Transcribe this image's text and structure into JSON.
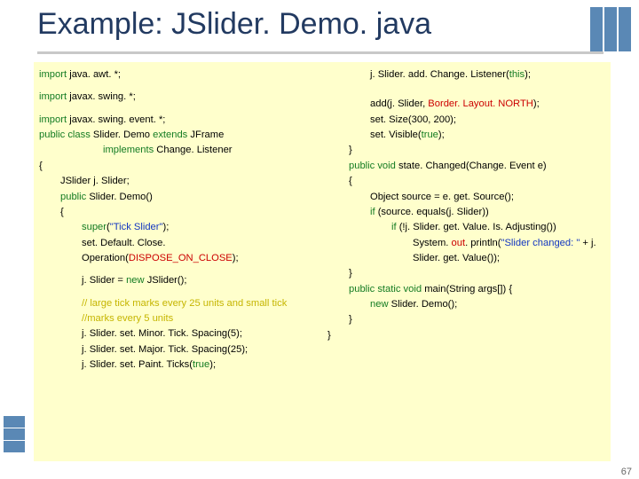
{
  "title": "Example: JSlider. Demo. java",
  "page_number": "67",
  "code": {
    "left": [
      {
        "cls": "",
        "parts": [
          {
            "c": "green",
            "t": "import"
          },
          {
            "t": " java. awt. *;"
          }
        ]
      },
      {
        "cls": "blank"
      },
      {
        "cls": "",
        "parts": [
          {
            "c": "green",
            "t": "import"
          },
          {
            "t": " javax. swing. *;"
          }
        ]
      },
      {
        "cls": "blank"
      },
      {
        "cls": "",
        "parts": [
          {
            "c": "green",
            "t": "import"
          },
          {
            "t": " javax. swing. event. *;"
          }
        ]
      },
      {
        "cls": "",
        "parts": [
          {
            "c": "green",
            "t": "public class"
          },
          {
            "t": " Slider. Demo "
          },
          {
            "c": "green",
            "t": "extends"
          },
          {
            "t": " JFrame"
          }
        ]
      },
      {
        "cls": "i3",
        "parts": [
          {
            "c": "green",
            "t": "implements"
          },
          {
            "t": " Change. Listener"
          }
        ]
      },
      {
        "cls": "",
        "parts": [
          {
            "t": "{"
          }
        ]
      },
      {
        "cls": "i1",
        "parts": [
          {
            "t": "JSlider j. Slider;"
          }
        ]
      },
      {
        "cls": "i1",
        "parts": [
          {
            "c": "green",
            "t": "public"
          },
          {
            "t": " Slider. Demo()"
          }
        ]
      },
      {
        "cls": "i1",
        "parts": [
          {
            "t": "{"
          }
        ]
      },
      {
        "cls": "i2",
        "parts": [
          {
            "c": "green",
            "t": "super"
          },
          {
            "t": "("
          },
          {
            "c": "blue",
            "t": "\"Tick Slider\""
          },
          {
            "t": ");"
          }
        ]
      },
      {
        "cls": "i2",
        "parts": [
          {
            "t": "set. Default. Close. Operation("
          },
          {
            "c": "red",
            "t": "DISPOSE_ON_CLOSE"
          },
          {
            "t": ");"
          }
        ]
      },
      {
        "cls": "blank"
      },
      {
        "cls": "i2",
        "parts": [
          {
            "t": "j. Slider = "
          },
          {
            "c": "green",
            "t": "new"
          },
          {
            "t": " JSlider();"
          }
        ]
      },
      {
        "cls": "blank"
      },
      {
        "cls": "i2",
        "parts": [
          {
            "c": "yel",
            "t": "// large tick marks every 25 units and small tick //marks every 5 units"
          }
        ]
      },
      {
        "cls": "i2",
        "parts": [
          {
            "t": "j. Slider. set. Minor. Tick. Spacing(5);"
          }
        ]
      },
      {
        "cls": "i2",
        "parts": [
          {
            "t": "j. Slider. set. Major. Tick. Spacing(25);"
          }
        ]
      },
      {
        "cls": "i2",
        "parts": [
          {
            "t": "j. Slider. set. Paint. Ticks("
          },
          {
            "c": "green",
            "t": "true"
          },
          {
            "t": ");"
          }
        ]
      }
    ],
    "right": [
      {
        "cls": "i2",
        "parts": [
          {
            "t": "j. Slider. add. Change. Listener("
          },
          {
            "c": "green",
            "t": "this"
          },
          {
            "t": ");"
          }
        ]
      },
      {
        "cls": "blank"
      },
      {
        "cls": "blank"
      },
      {
        "cls": "i2",
        "parts": [
          {
            "t": "add(j. Slider, "
          },
          {
            "c": "red",
            "t": "Border. Layout. NORTH"
          },
          {
            "t": ");"
          }
        ]
      },
      {
        "cls": "i2",
        "parts": [
          {
            "t": "set. Size(300, 200);"
          }
        ]
      },
      {
        "cls": "i2",
        "parts": [
          {
            "t": "set. Visible("
          },
          {
            "c": "green",
            "t": "true"
          },
          {
            "t": ");"
          }
        ]
      },
      {
        "cls": "i1",
        "parts": [
          {
            "t": "}"
          }
        ]
      },
      {
        "cls": "i1",
        "parts": [
          {
            "c": "green",
            "t": "public void"
          },
          {
            "t": " state. Changed(Change. Event e)"
          }
        ]
      },
      {
        "cls": "i1",
        "parts": [
          {
            "t": "{"
          }
        ]
      },
      {
        "cls": "i2",
        "parts": [
          {
            "t": "Object source = e. get. Source();"
          }
        ]
      },
      {
        "cls": "i2",
        "parts": [
          {
            "c": "green",
            "t": "if"
          },
          {
            "t": " (source. equals(j. Slider))"
          }
        ]
      },
      {
        "cls": "i3",
        "parts": [
          {
            "c": "green",
            "t": "if"
          },
          {
            "t": " (!j. Slider. get. Value. Is. Adjusting())"
          }
        ]
      },
      {
        "cls": "i4",
        "parts": [
          {
            "t": "System. "
          },
          {
            "c": "red",
            "t": "out"
          },
          {
            "t": ". println("
          },
          {
            "c": "blue",
            "t": "\"Slider changed: \""
          },
          {
            "t": " + j. Slider. get. Value());"
          }
        ]
      },
      {
        "cls": "i1",
        "parts": [
          {
            "t": "}"
          }
        ]
      },
      {
        "cls": "i1",
        "parts": [
          {
            "c": "green",
            "t": "public static void"
          },
          {
            "t": " main(String args[]) {"
          }
        ]
      },
      {
        "cls": "i2",
        "parts": [
          {
            "c": "green",
            "t": "new"
          },
          {
            "t": " Slider. Demo();"
          }
        ]
      },
      {
        "cls": "i1",
        "parts": [
          {
            "t": "}"
          }
        ]
      },
      {
        "cls": "",
        "parts": [
          {
            "t": "}"
          }
        ]
      }
    ]
  }
}
